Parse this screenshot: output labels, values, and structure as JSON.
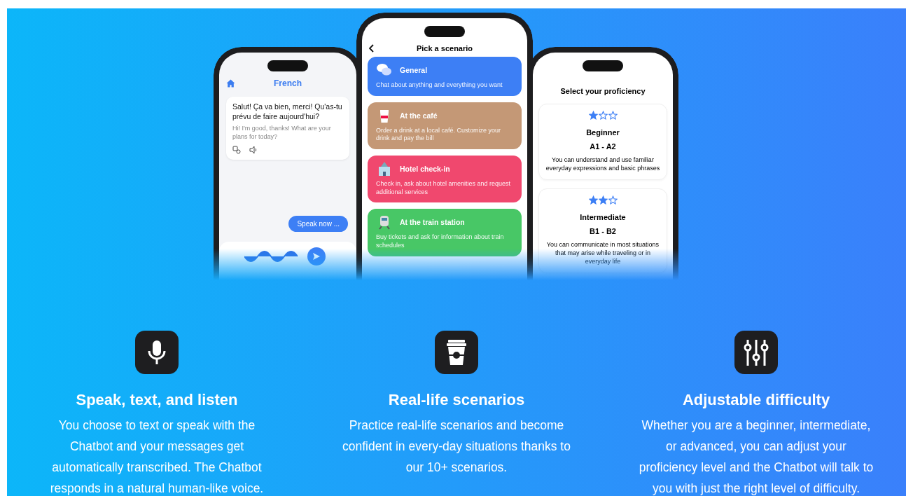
{
  "phones": [
    {
      "kind": "chat",
      "title": "French",
      "message": "Salut! Ça va bien, merci! Qu'as-tu prévu de faire aujourd'hui?",
      "translation": "Hi! I'm good, thanks! What are your plans for today?",
      "speak_button": "Speak now ..."
    },
    {
      "kind": "scenarios",
      "title": "Pick a scenario",
      "items": [
        {
          "title": "General",
          "description": "Chat about anything and everything you want",
          "color": "#3d7ff5"
        },
        {
          "title": "At the café",
          "description": "Order a drink at a local café. Customize your drink and pay the bill",
          "color": "#c49876"
        },
        {
          "title": "Hotel check-in",
          "description": "Check in, ask about hotel amenities and request additional services",
          "color": "#f0486e"
        },
        {
          "title": "At the train station",
          "description": "Buy tickets and ask for information about train schedules",
          "color": "#48c766"
        }
      ]
    },
    {
      "kind": "proficiency",
      "title": "Select your proficiency",
      "levels": [
        {
          "name": "Beginner",
          "range": "A1 - A2",
          "description": "You can understand and use familiar everyday expressions and basic phrases",
          "stars": 1
        },
        {
          "name": "Intermediate",
          "range": "B1 - B2",
          "description": "You can communicate in most situations that may arise while traveling or in everyday life",
          "stars": 2
        }
      ]
    }
  ],
  "features": [
    {
      "kind": "mic",
      "title": "Speak, text, and listen",
      "text": "You choose to text or speak with the Chatbot and your messages get automatically transcribed. The Chatbot responds in a natural human-like voice."
    },
    {
      "kind": "cup",
      "title": "Real-life scenarios",
      "text": "Practice real-life scenarios and become confident in every-day situations thanks to our 10+ scenarios."
    },
    {
      "kind": "sliders",
      "title": "Adjustable difficulty",
      "text": "Whether you are a beginner, intermediate, or advanced, you can adjust your proficiency level and the Chatbot will talk to you with just the right level of difficulty."
    }
  ]
}
